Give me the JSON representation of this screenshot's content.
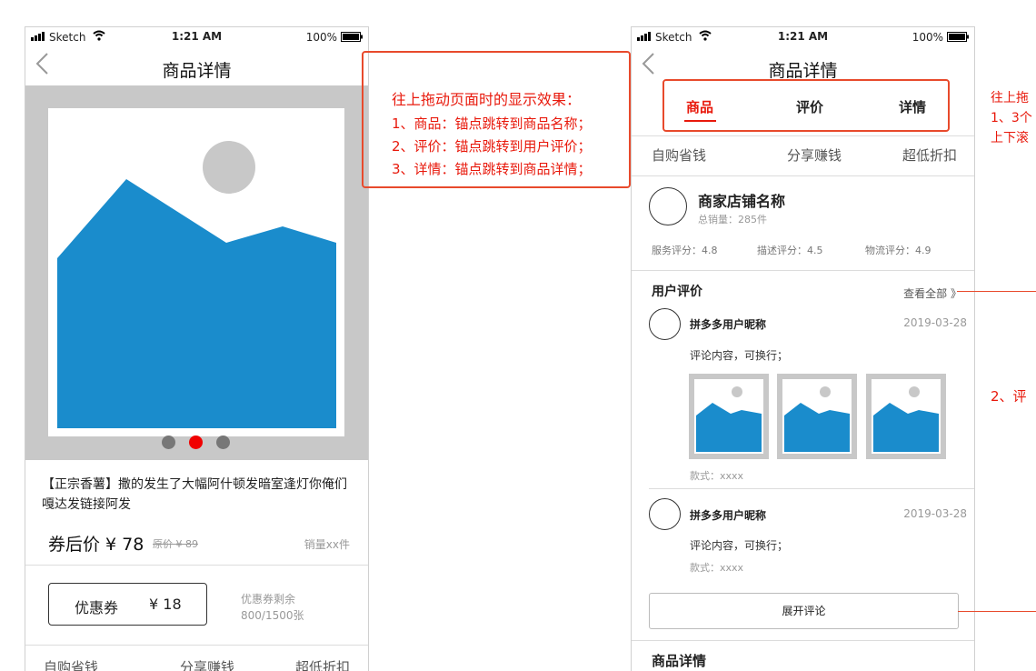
{
  "status_bar": {
    "carrier": "Sketch",
    "time": "1:21 AM",
    "battery": "100%"
  },
  "nav": {
    "title": "商品详情"
  },
  "product": {
    "name": "【正宗香薯】撒的发生了大幅阿什顿发暗室逢灯你俺们嘎达发链接阿发",
    "price_label": "券后价 ¥ 78",
    "original_price": "原价 ¥ 89",
    "sales": "销量xx件",
    "carousel_dots": [
      false,
      true,
      false
    ]
  },
  "coupon": {
    "label": "优惠券",
    "amount": "¥ 18",
    "remain_label": "优惠券剩余",
    "remain_count": "800/1500张"
  },
  "promo": {
    "items": [
      "自购省钱",
      "分享赚钱",
      "超低折扣"
    ]
  },
  "annotation": {
    "title": "往上拖动页面时的显示效果：",
    "lines": [
      "1、商品：锚点跳转到商品名称；",
      "2、评价：锚点跳转到用户评价；",
      "3、详情：锚点跳转到商品详情；"
    ]
  },
  "anchor_tabs": {
    "items": [
      "商品",
      "评价",
      "详情"
    ],
    "active_index": 0
  },
  "shop": {
    "name": "商家店铺名称",
    "total_sales": "总销量：285件",
    "scores": [
      "服务评分：4.8",
      "描述评分：4.5",
      "物流评分：4.9"
    ]
  },
  "reviews": {
    "title": "用户评价",
    "view_all": "查看全部 》",
    "items": [
      {
        "user": "拼多多用户昵称",
        "date": "2019-03-28",
        "content": "评论内容，可换行；",
        "style": "款式：xxxx"
      },
      {
        "user": "拼多多用户昵称",
        "date": "2019-03-28",
        "content": "评论内容，可换行；",
        "style": "款式：xxxx"
      }
    ],
    "expand_label": "展开评论"
  },
  "detail": {
    "title": "商品详情"
  },
  "right_notes": {
    "note1": "往上拖",
    "note2": "1、3个",
    "note3": "上下滚",
    "note4": "2、评"
  },
  "colors": {
    "accent": "#e8190c",
    "image_blue": "#1a8ccc",
    "image_gray": "#c8c8c8"
  }
}
